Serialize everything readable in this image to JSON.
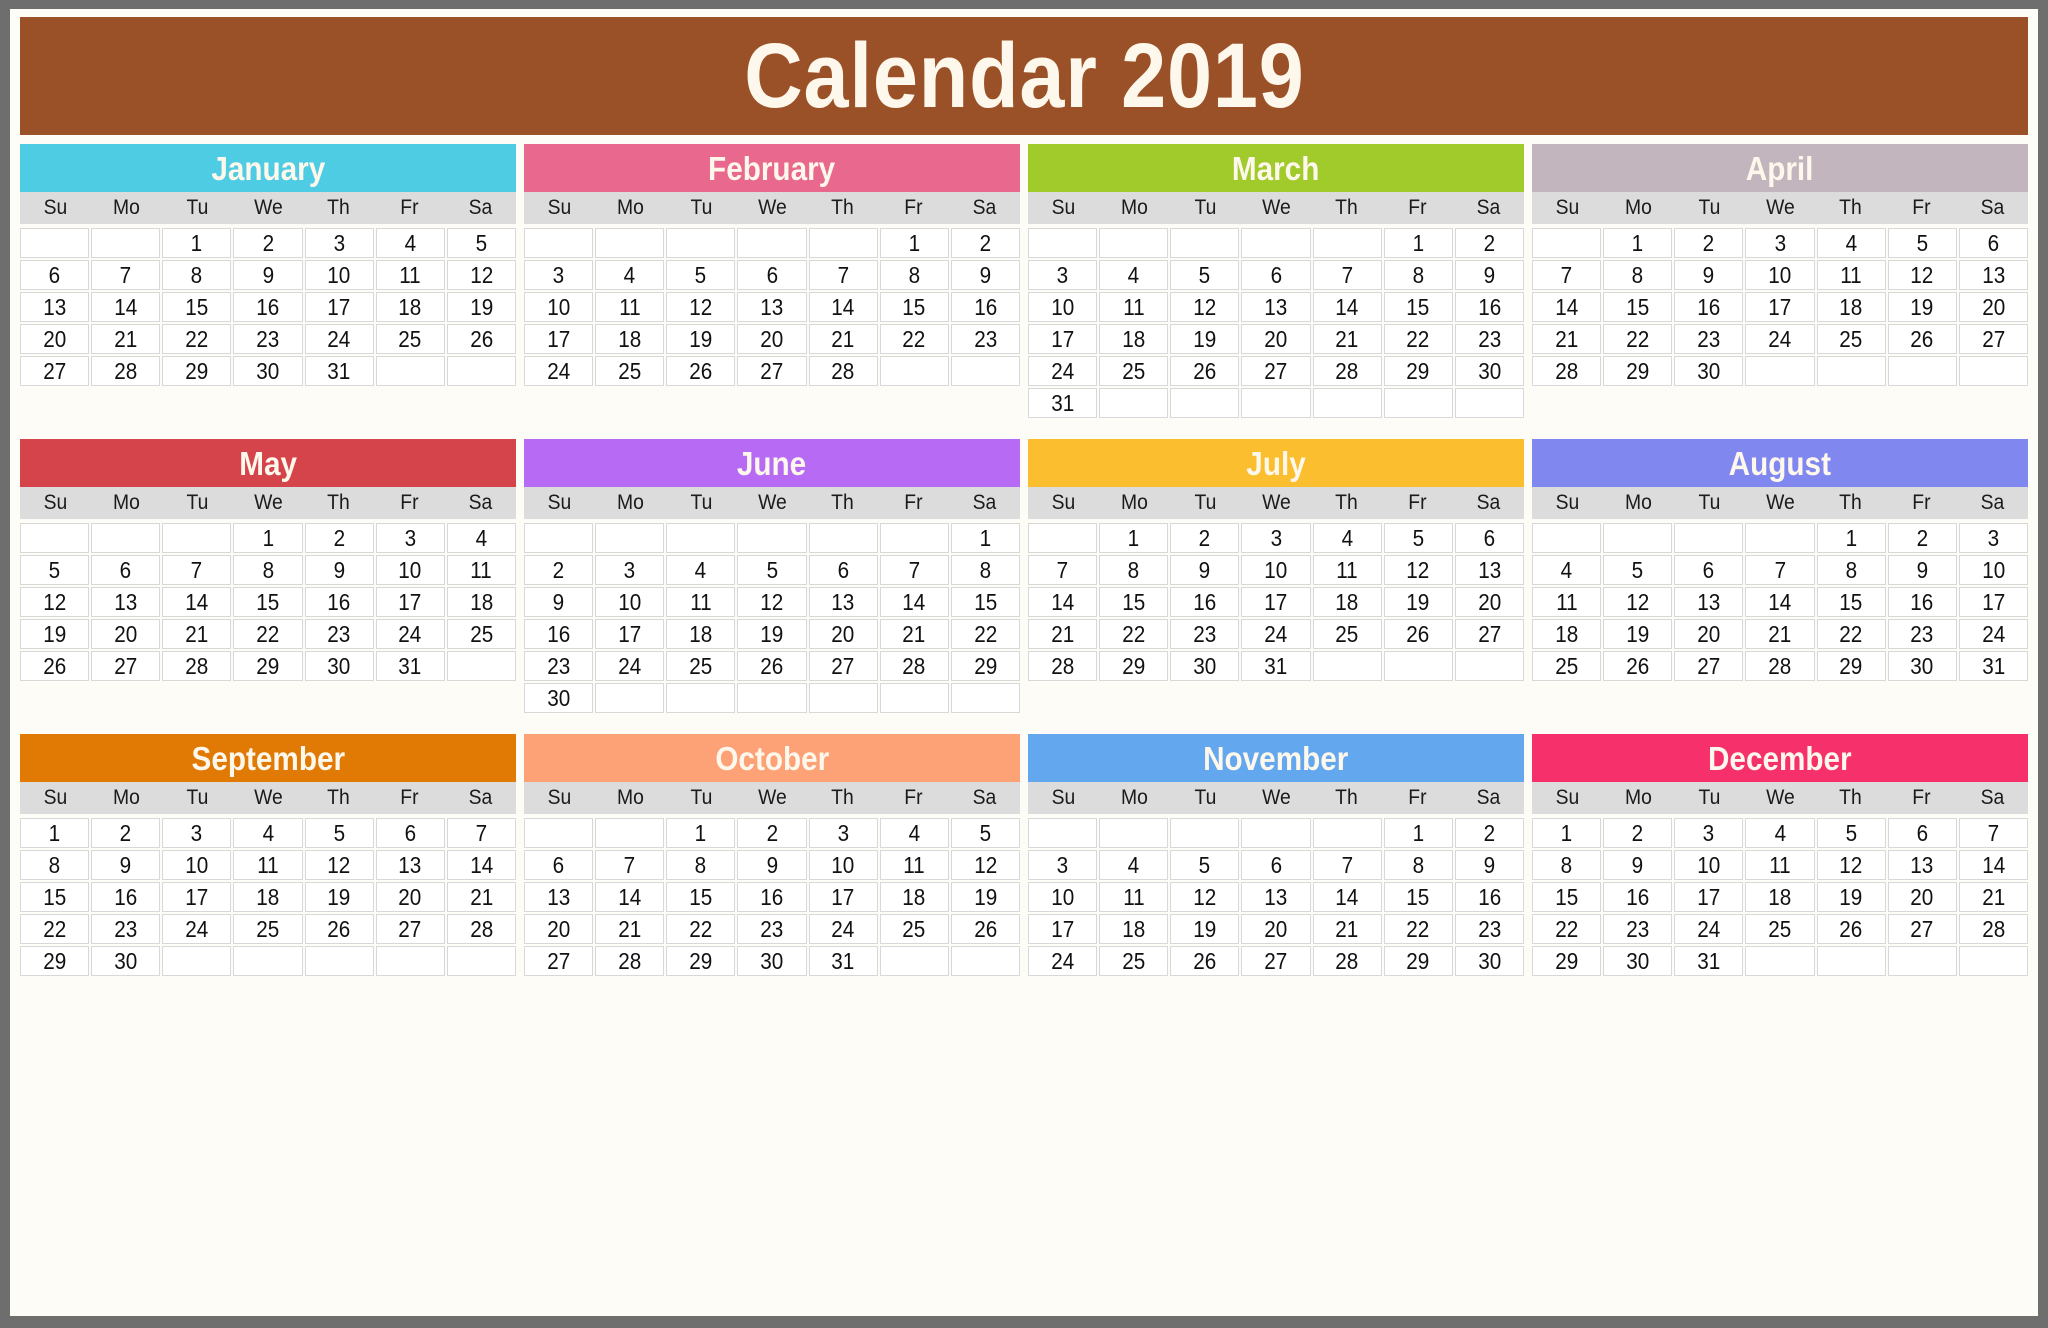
{
  "title": "Calendar 2019",
  "colors": {
    "title_bar": "#9a5127",
    "title_text": "#fdf7ec",
    "page_background": "#fdfcf7",
    "outer_frame": "#6e6e6e",
    "weekday_row": "#dcdcdc",
    "day_cell": "#ffffff",
    "day_border": "#d8d8d8"
  },
  "weekdays": [
    "Su",
    "Mo",
    "Tu",
    "We",
    "Th",
    "Fr",
    "Sa"
  ],
  "months": [
    {
      "name": "January",
      "color": "#4ecce3",
      "weeks": [
        [
          "",
          "",
          "1",
          "2",
          "3",
          "4",
          "5"
        ],
        [
          "6",
          "7",
          "8",
          "9",
          "10",
          "11",
          "12"
        ],
        [
          "13",
          "14",
          "15",
          "16",
          "17",
          "18",
          "19"
        ],
        [
          "20",
          "21",
          "22",
          "23",
          "24",
          "25",
          "26"
        ],
        [
          "27",
          "28",
          "29",
          "30",
          "31",
          "",
          ""
        ]
      ]
    },
    {
      "name": "February",
      "color": "#e8688e",
      "weeks": [
        [
          "",
          "",
          "",
          "",
          "",
          "1",
          "2"
        ],
        [
          "3",
          "4",
          "5",
          "6",
          "7",
          "8",
          "9"
        ],
        [
          "10",
          "11",
          "12",
          "13",
          "14",
          "15",
          "16"
        ],
        [
          "17",
          "18",
          "19",
          "20",
          "21",
          "22",
          "23"
        ],
        [
          "24",
          "25",
          "26",
          "27",
          "28",
          "",
          ""
        ]
      ]
    },
    {
      "name": "March",
      "color": "#a0cb2a",
      "weeks": [
        [
          "",
          "",
          "",
          "",
          "",
          "1",
          "2"
        ],
        [
          "3",
          "4",
          "5",
          "6",
          "7",
          "8",
          "9"
        ],
        [
          "10",
          "11",
          "12",
          "13",
          "14",
          "15",
          "16"
        ],
        [
          "17",
          "18",
          "19",
          "20",
          "21",
          "22",
          "23"
        ],
        [
          "24",
          "25",
          "26",
          "27",
          "28",
          "29",
          "30"
        ],
        [
          "31",
          "",
          "",
          "",
          "",
          "",
          ""
        ]
      ]
    },
    {
      "name": "April",
      "color": "#c3b5bd",
      "weeks": [
        [
          "",
          "1",
          "2",
          "3",
          "4",
          "5",
          "6"
        ],
        [
          "7",
          "8",
          "9",
          "10",
          "11",
          "12",
          "13"
        ],
        [
          "14",
          "15",
          "16",
          "17",
          "18",
          "19",
          "20"
        ],
        [
          "21",
          "22",
          "23",
          "24",
          "25",
          "26",
          "27"
        ],
        [
          "28",
          "29",
          "30",
          "",
          "",
          "",
          ""
        ]
      ]
    },
    {
      "name": "May",
      "color": "#d4444a",
      "weeks": [
        [
          "",
          "",
          "",
          "1",
          "2",
          "3",
          "4"
        ],
        [
          "5",
          "6",
          "7",
          "8",
          "9",
          "10",
          "11"
        ],
        [
          "12",
          "13",
          "14",
          "15",
          "16",
          "17",
          "18"
        ],
        [
          "19",
          "20",
          "21",
          "22",
          "23",
          "24",
          "25"
        ],
        [
          "26",
          "27",
          "28",
          "29",
          "30",
          "31",
          ""
        ]
      ]
    },
    {
      "name": "June",
      "color": "#b76bf5",
      "weeks": [
        [
          "",
          "",
          "",
          "",
          "",
          "",
          "1"
        ],
        [
          "2",
          "3",
          "4",
          "5",
          "6",
          "7",
          "8"
        ],
        [
          "9",
          "10",
          "11",
          "12",
          "13",
          "14",
          "15"
        ],
        [
          "16",
          "17",
          "18",
          "19",
          "20",
          "21",
          "22"
        ],
        [
          "23",
          "24",
          "25",
          "26",
          "27",
          "28",
          "29"
        ],
        [
          "30",
          "",
          "",
          "",
          "",
          "",
          ""
        ]
      ]
    },
    {
      "name": "July",
      "color": "#fbbe2e",
      "weeks": [
        [
          "",
          "1",
          "2",
          "3",
          "4",
          "5",
          "6"
        ],
        [
          "7",
          "8",
          "9",
          "10",
          "11",
          "12",
          "13"
        ],
        [
          "14",
          "15",
          "16",
          "17",
          "18",
          "19",
          "20"
        ],
        [
          "21",
          "22",
          "23",
          "24",
          "25",
          "26",
          "27"
        ],
        [
          "28",
          "29",
          "30",
          "31",
          "",
          "",
          ""
        ]
      ]
    },
    {
      "name": "August",
      "color": "#8088f0",
      "weeks": [
        [
          "",
          "",
          "",
          "",
          "1",
          "2",
          "3"
        ],
        [
          "4",
          "5",
          "6",
          "7",
          "8",
          "9",
          "10"
        ],
        [
          "11",
          "12",
          "13",
          "14",
          "15",
          "16",
          "17"
        ],
        [
          "18",
          "19",
          "20",
          "21",
          "22",
          "23",
          "24"
        ],
        [
          "25",
          "26",
          "27",
          "28",
          "29",
          "30",
          "31"
        ]
      ]
    },
    {
      "name": "September",
      "color": "#e07a04",
      "weeks": [
        [
          "1",
          "2",
          "3",
          "4",
          "5",
          "6",
          "7"
        ],
        [
          "8",
          "9",
          "10",
          "11",
          "12",
          "13",
          "14"
        ],
        [
          "15",
          "16",
          "17",
          "18",
          "19",
          "20",
          "21"
        ],
        [
          "22",
          "23",
          "24",
          "25",
          "26",
          "27",
          "28"
        ],
        [
          "29",
          "30",
          "",
          "",
          "",
          "",
          ""
        ]
      ]
    },
    {
      "name": "October",
      "color": "#fda177",
      "weeks": [
        [
          "",
          "",
          "1",
          "2",
          "3",
          "4",
          "5"
        ],
        [
          "6",
          "7",
          "8",
          "9",
          "10",
          "11",
          "12"
        ],
        [
          "13",
          "14",
          "15",
          "16",
          "17",
          "18",
          "19"
        ],
        [
          "20",
          "21",
          "22",
          "23",
          "24",
          "25",
          "26"
        ],
        [
          "27",
          "28",
          "29",
          "30",
          "31",
          "",
          ""
        ]
      ]
    },
    {
      "name": "November",
      "color": "#63a8ee",
      "weeks": [
        [
          "",
          "",
          "",
          "",
          "",
          "1",
          "2"
        ],
        [
          "3",
          "4",
          "5",
          "6",
          "7",
          "8",
          "9"
        ],
        [
          "10",
          "11",
          "12",
          "13",
          "14",
          "15",
          "16"
        ],
        [
          "17",
          "18",
          "19",
          "20",
          "21",
          "22",
          "23"
        ],
        [
          "24",
          "25",
          "26",
          "27",
          "28",
          "29",
          "30"
        ]
      ]
    },
    {
      "name": "December",
      "color": "#f5306b",
      "weeks": [
        [
          "1",
          "2",
          "3",
          "4",
          "5",
          "6",
          "7"
        ],
        [
          "8",
          "9",
          "10",
          "11",
          "12",
          "13",
          "14"
        ],
        [
          "15",
          "16",
          "17",
          "18",
          "19",
          "20",
          "21"
        ],
        [
          "22",
          "23",
          "24",
          "25",
          "26",
          "27",
          "28"
        ],
        [
          "29",
          "30",
          "31",
          "",
          "",
          "",
          ""
        ]
      ]
    }
  ]
}
